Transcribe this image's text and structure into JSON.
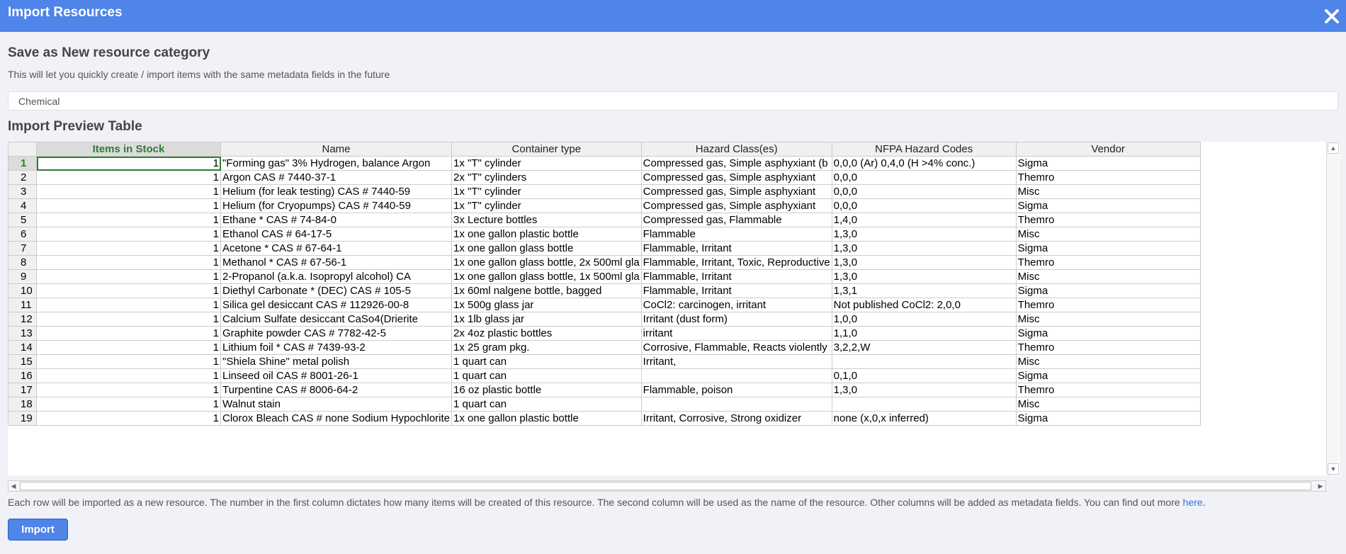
{
  "window": {
    "title": "Import Resources"
  },
  "category": {
    "heading": "Save as New resource category",
    "description": "This will let you quickly create / import items with the same metadata fields in the future",
    "value": "Chemical"
  },
  "preview": {
    "heading": "Import Preview Table",
    "columns": [
      "Items in Stock",
      "Name",
      "Container type",
      "Hazard Class(es)",
      "NFPA Hazard Codes",
      "Vendor"
    ],
    "rows": [
      [
        "1",
        "1",
        "\"Forming gas\" 3% Hydrogen, balance Argon",
        "1x \"T\" cylinder",
        "Compressed gas, Simple asphyxiant (b",
        "0,0,0 (Ar) 0,4,0 (H >4% conc.)",
        "Sigma"
      ],
      [
        "2",
        "1",
        "Argon CAS # 7440-37-1",
        "2x \"T\" cylinders",
        "Compressed gas, Simple asphyxiant",
        "0,0,0",
        "Themro"
      ],
      [
        "3",
        "1",
        "Helium (for leak testing) CAS # 7440-59",
        "1x \"T\" cylinder",
        "Compressed gas, Simple asphyxiant",
        "0,0,0",
        "Misc"
      ],
      [
        "4",
        "1",
        "Helium (for Cryopumps) CAS # 7440-59",
        "1x \"T\" cylinder",
        "Compressed gas, Simple asphyxiant",
        "0,0,0",
        "Sigma"
      ],
      [
        "5",
        "1",
        "Ethane * CAS # 74-84-0",
        "3x Lecture bottles",
        "Compressed gas, Flammable",
        "1,4,0",
        "Themro"
      ],
      [
        "6",
        "1",
        "Ethanol CAS # 64-17-5",
        "1x one gallon plastic bottle",
        "Flammable",
        "1,3,0",
        "Misc"
      ],
      [
        "7",
        "1",
        "Acetone * CAS # 67-64-1",
        "1x one gallon glass bottle",
        "Flammable, Irritant",
        "1,3,0",
        "Sigma"
      ],
      [
        "8",
        "1",
        "Methanol * CAS # 67-56-1",
        "1x one gallon glass bottle, 2x 500ml gla",
        "Flammable, Irritant, Toxic, Reproductive",
        "1,3,0",
        "Themro"
      ],
      [
        "9",
        "1",
        "2-Propanol (a.k.a. Isopropyl alcohol) CA",
        "1x one gallon glass bottle, 1x 500ml gla",
        "Flammable, Irritant",
        "1,3,0",
        "Misc"
      ],
      [
        "10",
        "1",
        "Diethyl Carbonate * (DEC) CAS # 105-5",
        "1x 60ml nalgene bottle, bagged",
        "Flammable, Irritant",
        "1,3,1",
        "Sigma"
      ],
      [
        "11",
        "1",
        "Silica gel desiccant CAS # 112926-00-8",
        "1x 500g glass jar",
        "CoCl2: carcinogen, irritant",
        "Not published CoCl2: 2,0,0",
        "Themro"
      ],
      [
        "12",
        "1",
        "Calcium Sulfate desiccant CaSo4(Drierite",
        "1x 1lb glass jar",
        "Irritant (dust form)",
        "1,0,0",
        "Misc"
      ],
      [
        "13",
        "1",
        "Graphite powder CAS # 7782-42-5",
        "2x 4oz plastic bottles",
        "irritant",
        "1,1,0",
        "Sigma"
      ],
      [
        "14",
        "1",
        "Lithium foil * CAS # 7439-93-2",
        "1x 25 gram pkg.",
        "Corrosive, Flammable, Reacts violently",
        "3,2,2,W",
        "Themro"
      ],
      [
        "15",
        "1",
        "\"Shiela Shine\" metal polish",
        "1 quart can",
        "Irritant,",
        "",
        "Misc"
      ],
      [
        "16",
        "1",
        "Linseed oil CAS # 8001-26-1",
        "1 quart can",
        "",
        "0,1,0",
        "Sigma"
      ],
      [
        "17",
        "1",
        "Turpentine CAS # 8006-64-2",
        "16 oz plastic bottle",
        "Flammable, poison",
        "1,3,0",
        "Themro"
      ],
      [
        "18",
        "1",
        "Walnut stain",
        "1 quart can",
        "",
        "",
        "Misc"
      ],
      [
        "19",
        "1",
        "Clorox Bleach CAS # none Sodium Hypochlorite",
        "1x one gallon plastic bottle",
        "Irritant, Corrosive, Strong oxidizer",
        "none  (x,0,x inferred)",
        "Sigma"
      ]
    ]
  },
  "footer": {
    "note": "Each row will be imported as a new resource. The number in the first column dictates how many items will be created of this resource. The second column will be used as the name of the resource. Other columns will be added as metadata fields. You can find out more ",
    "link": "here",
    "period": ".",
    "import_label": "Import"
  },
  "icons": {
    "close": "close-icon"
  },
  "colors": {
    "accent": "#4f84e8",
    "selection": "#2e7d32"
  }
}
